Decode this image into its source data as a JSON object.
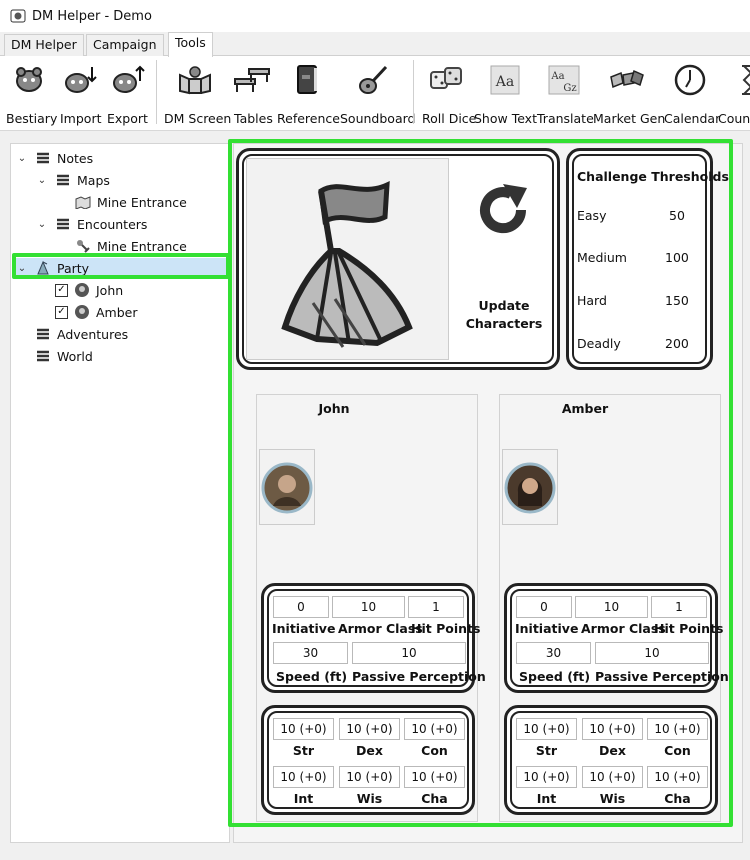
{
  "window": {
    "title": "DM Helper - Demo"
  },
  "tabs": [
    {
      "label": "DM Helper"
    },
    {
      "label": "Campaign"
    },
    {
      "label": "Tools"
    }
  ],
  "ribbon": [
    {
      "label": "Bestiary",
      "icon": "bestiary-icon"
    },
    {
      "label": "Import",
      "icon": "import-icon"
    },
    {
      "label": "Export",
      "icon": "export-icon"
    },
    {
      "label": "DM Screen",
      "icon": "dm-screen-icon"
    },
    {
      "label": "Tables",
      "icon": "tables-icon"
    },
    {
      "label": "Reference",
      "icon": "reference-icon"
    },
    {
      "label": "Soundboard",
      "icon": "soundboard-icon"
    },
    {
      "label": "Roll Dice",
      "icon": "dice-icon"
    },
    {
      "label": "Show Text",
      "icon": "show-text-icon"
    },
    {
      "label": "Translate",
      "icon": "translate-icon"
    },
    {
      "label": "Market Gen",
      "icon": "market-gen-icon"
    },
    {
      "label": "Calendar",
      "icon": "calendar-icon"
    },
    {
      "label": "Count",
      "icon": "countdown-icon"
    }
  ],
  "tree": {
    "notes": "Notes",
    "maps": "Maps",
    "maps_child": "Mine Entrance",
    "encounters": "Encounters",
    "encounters_child": "Mine Entrance",
    "party": "Party",
    "party_members": [
      "John",
      "Amber"
    ],
    "adventures": "Adventures",
    "world": "World"
  },
  "party_view": {
    "update_label_1": "Update",
    "update_label_2": "Characters",
    "challenge": {
      "title": "Challenge Thresholds",
      "rows": [
        {
          "label": "Easy",
          "value": "50"
        },
        {
          "label": "Medium",
          "value": "100"
        },
        {
          "label": "Hard",
          "value": "150"
        },
        {
          "label": "Deadly",
          "value": "200"
        }
      ]
    },
    "stat_labels": {
      "initiative": "Initiative",
      "armor_class": "Armor Class",
      "hit_points": "Hit Points",
      "speed": "Speed (ft)",
      "passive_perception": "Passive Perception",
      "str": "Str",
      "dex": "Dex",
      "con": "Con",
      "int": "Int",
      "wis": "Wis",
      "cha": "Cha"
    },
    "characters": [
      {
        "name": "John",
        "initiative": "0",
        "armor_class": "10",
        "hit_points": "1",
        "speed": "30",
        "passive_perception": "10",
        "str": "10 (+0)",
        "dex": "10 (+0)",
        "con": "10 (+0)",
        "int": "10 (+0)",
        "wis": "10 (+0)",
        "cha": "10 (+0)"
      },
      {
        "name": "Amber",
        "initiative": "0",
        "armor_class": "10",
        "hit_points": "1",
        "speed": "30",
        "passive_perception": "10",
        "str": "10 (+0)",
        "dex": "10 (+0)",
        "con": "10 (+0)",
        "int": "10 (+0)",
        "wis": "10 (+0)",
        "cha": "10 (+0)"
      }
    ]
  },
  "colors": {
    "highlight": "#33e033",
    "selection": "#cce4f7"
  }
}
